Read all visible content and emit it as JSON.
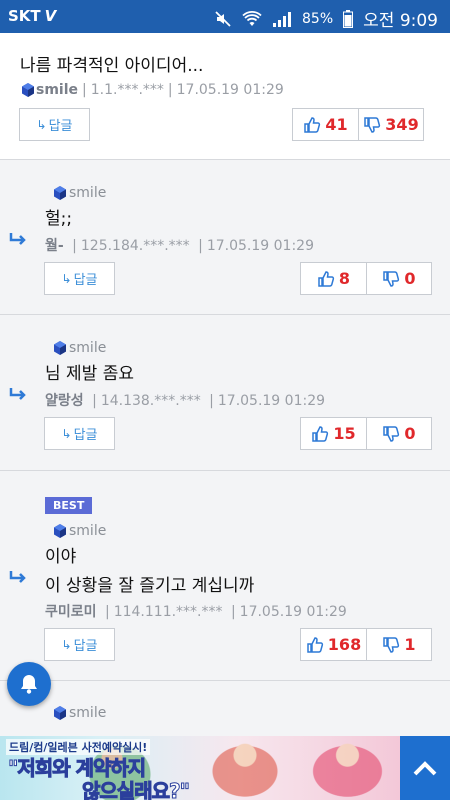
{
  "status_bar": {
    "carrier": "SKT",
    "battery": "85%",
    "time": "오전 9:09",
    "colors": {
      "background": "#1f5fae"
    }
  },
  "comments": [
    {
      "text": "나름 파격적인 아이디어...",
      "author": "smile",
      "ip": "1.1.***.***",
      "date": "17.05.19 01:29",
      "reply_label": "답글",
      "likes": "41",
      "dislikes": "349"
    },
    {
      "nick": "smile",
      "text": "헐;;",
      "author": "월-",
      "ip": "125.184.***.***",
      "date": "17.05.19 01:29",
      "reply_label": "답글",
      "likes": "8",
      "dislikes": "0"
    },
    {
      "nick": "smile",
      "text": "님 제발 좀요",
      "author": "얄랑성",
      "ip": "14.138.***.***",
      "date": "17.05.19 01:29",
      "reply_label": "답글",
      "likes": "15",
      "dislikes": "0"
    },
    {
      "badge": "BEST",
      "nick": "smile",
      "text_line1": "이야",
      "text_line2": "이 상황을 잘 즐기고 계십니까",
      "author": "쿠미로미",
      "ip": "114.111.***.***",
      "date": "17.05.19 01:29",
      "reply_label": "답글",
      "likes": "168",
      "dislikes": "1"
    },
    {
      "nick": "smile"
    }
  ],
  "ad": {
    "line1": "드림/컴/일레븐 사전예약실시!",
    "line2": "\"저희와 계약하지",
    "line3": "않으실래요?\""
  },
  "icons": {
    "thumb_up": "thumbs-up-icon",
    "thumb_down": "thumbs-down-icon",
    "bell": "bell-icon",
    "scroll_top": "chevron-up-icon"
  },
  "colors": {
    "accent": "#1e6fcf",
    "vote_count": "#e0282b",
    "reply_text": "#3d8fd8",
    "best_badge": "#5b6bd6"
  }
}
